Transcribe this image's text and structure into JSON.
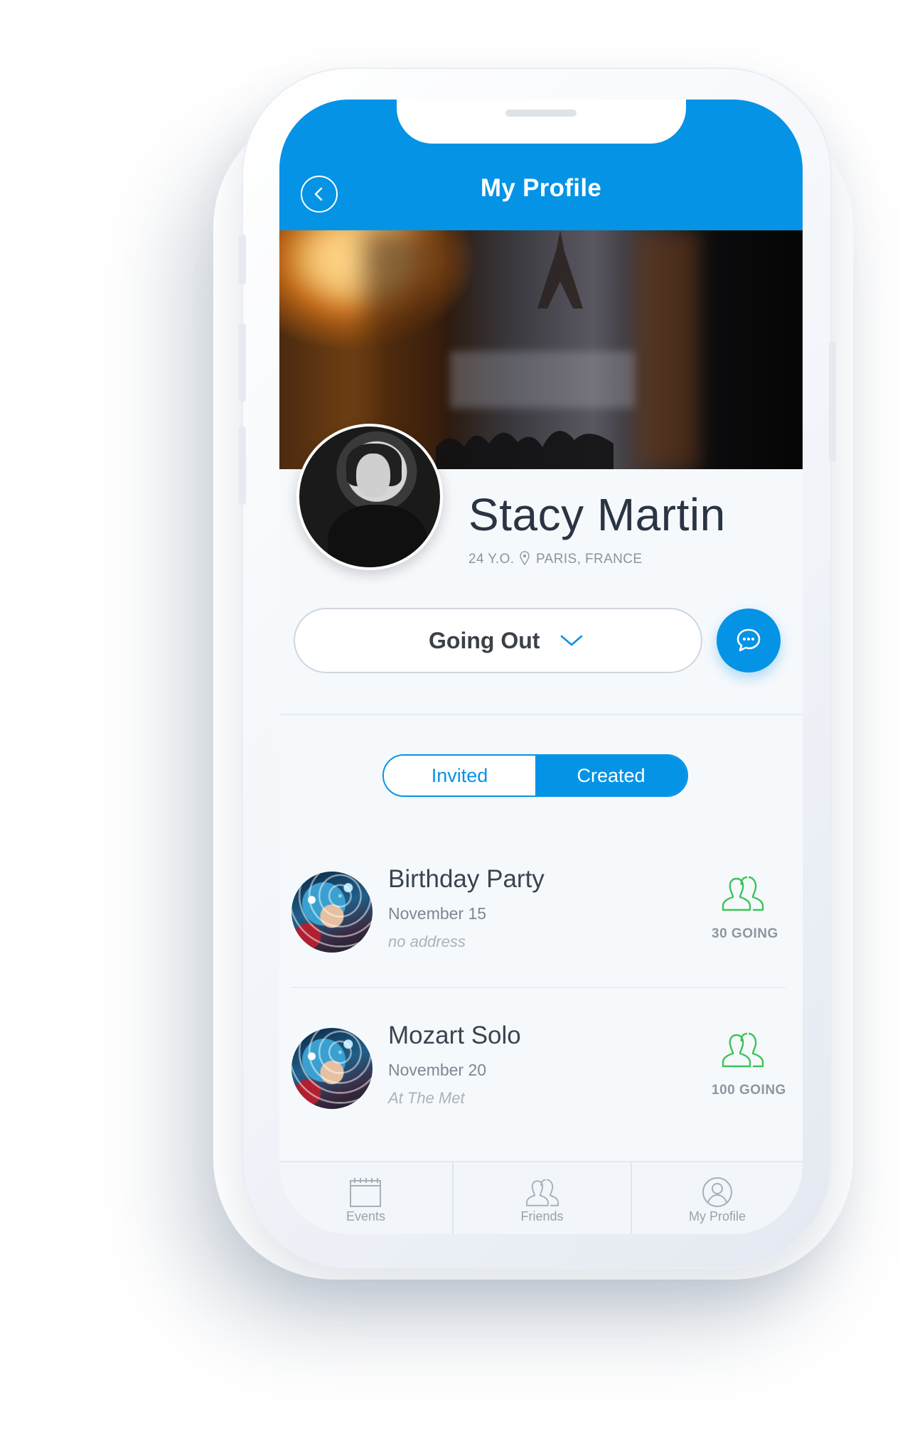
{
  "header": {
    "title": "My Profile",
    "back_icon": "chevron-left-icon",
    "color": "#0593e6"
  },
  "profile": {
    "name": "Stacy Martin",
    "age": "24 Y.O.",
    "location": "PARIS, FRANCE",
    "location_icon": "map-pin-icon"
  },
  "status": {
    "selected": "Going Out",
    "dropdown_icon": "chevron-down-icon",
    "chat_icon": "chat-bubble-icon"
  },
  "segments": {
    "invited": "Invited",
    "created": "Created",
    "active": "Created"
  },
  "events": [
    {
      "title": "Birthday Party",
      "date": "November 15",
      "address": "no address",
      "going": "30 GOING",
      "going_color": "#3cc45a"
    },
    {
      "title": "Mozart Solo",
      "date": "November 20",
      "address": "At The Met",
      "going": "100 GOING",
      "going_color": "#3cc45a"
    }
  ],
  "tabbar": {
    "tabs": [
      {
        "label": "Events",
        "icon": "calendar-icon"
      },
      {
        "label": "Friends",
        "icon": "friends-icon"
      },
      {
        "label": "My Profile",
        "icon": "profile-icon"
      }
    ]
  }
}
